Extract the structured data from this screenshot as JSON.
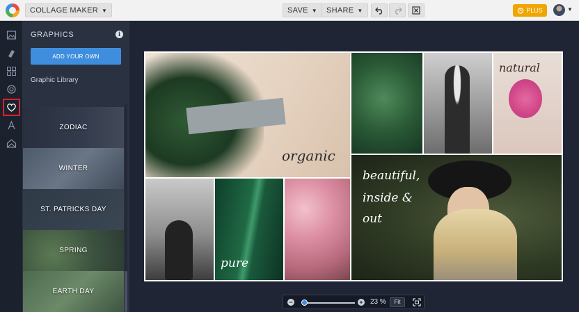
{
  "header": {
    "collage_maker_label": "COLLAGE MAKER",
    "save_label": "SAVE",
    "share_label": "SHARE",
    "plus_label": "PLUS"
  },
  "rail": {
    "icons": [
      "image-icon",
      "brush-icon",
      "layout-grid-icon",
      "circle-icon",
      "heart-icon",
      "text-icon",
      "texture-icon"
    ],
    "active": "heart-icon",
    "active_color": "#e0202a"
  },
  "panel": {
    "title": "GRAPHICS",
    "add_button_label": "ADD YOUR OWN",
    "library_label": "Graphic Library",
    "tiles": [
      "ZODIAC",
      "WINTER",
      "ST. PATRICKS DAY",
      "SPRING",
      "EARTH DAY"
    ]
  },
  "collage": {
    "captions": {
      "organic": "organic",
      "natural": "natural",
      "pure": "pure",
      "beautiful_1": "beautiful,",
      "beautiful_2": "inside &",
      "beautiful_3": "out"
    }
  },
  "zoom": {
    "value_label": "23 %",
    "level": 0.23,
    "fit_label": "Fit"
  },
  "colors": {
    "accent_blue": "#3f8ede",
    "plus_orange": "#f0a500",
    "canvas_bg": "#1f2535"
  }
}
